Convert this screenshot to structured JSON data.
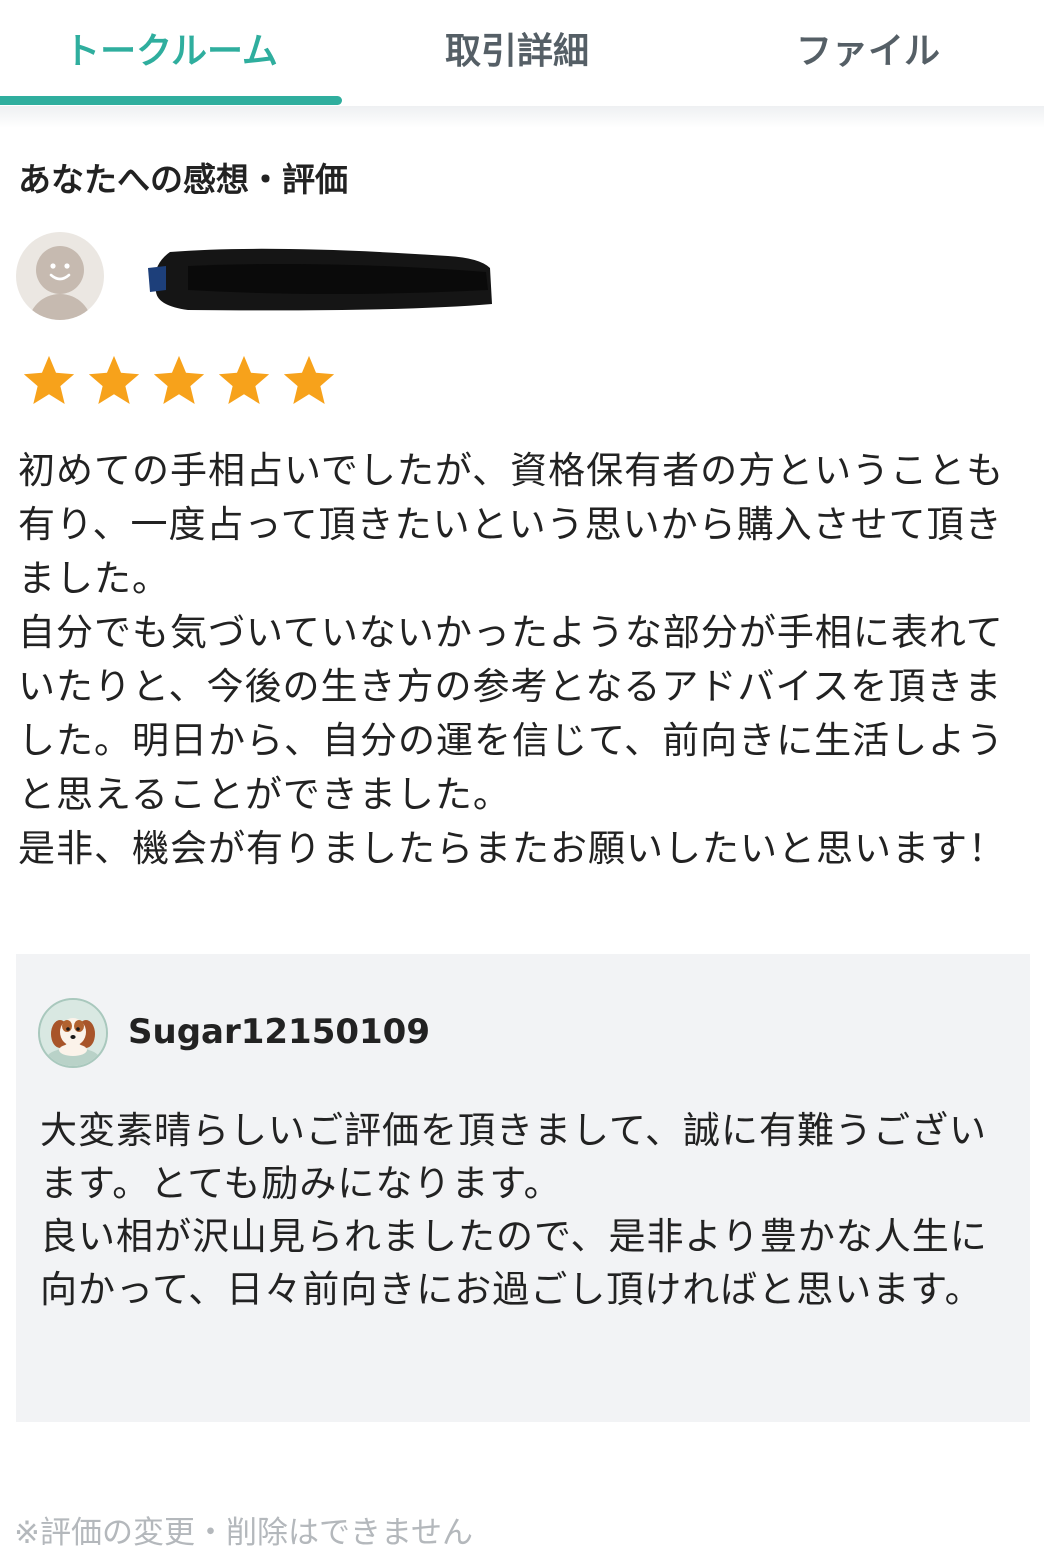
{
  "tabs": {
    "talk_room": "トークルーム",
    "deal_detail": "取引詳細",
    "file": "ファイル",
    "active": "talk_room",
    "accent_color": "#2fae9e"
  },
  "review": {
    "section_title": "あなたへの感想・評価",
    "reviewer_name_redacted": true,
    "rating": 5,
    "rating_max": 5,
    "star_color": "#f7a21b",
    "paragraphs": [
      "初めての手相占いでしたが、資格保有者の方ということも有り、一度占って頂きたいという思いから購入させて頂きました。",
      "自分でも気づいていないかったような部分が手相に表れていたりと、今後の生き方の参考となるアドバイスを頂きました。明日から、自分の運を信じて、前向きに生活しようと思えることができました。",
      "是非、機会が有りましたらまたお願いしたいと思います！"
    ]
  },
  "reply": {
    "seller_name": "Sugar12150109",
    "avatar_icon": "dog-icon",
    "paragraphs": [
      "大変素晴らしいご評価を頂きまして、誠に有難うございます。とても励みになります。",
      "良い相が沢山見られましたので、是非より豊かな人生に向かって、日々前向きにお過ごし頂ければと思います。"
    ]
  },
  "footer": {
    "note": "※評価の変更・削除はできません"
  }
}
